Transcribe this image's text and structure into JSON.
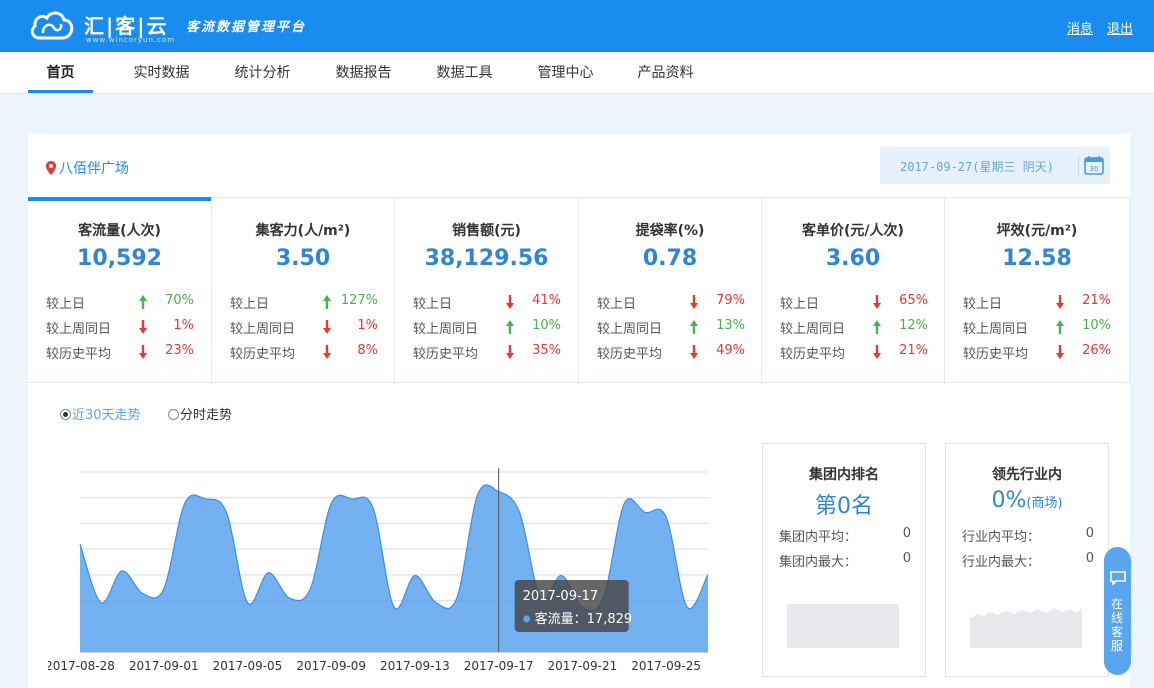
{
  "header": {
    "brand": "汇|客|云",
    "brand_sub": "www.wincoryun.com",
    "slogan": "客流数据管理平台",
    "links": {
      "messages": "消息",
      "logout": "退出"
    }
  },
  "nav": {
    "items": [
      "首页",
      "实时数据",
      "统计分析",
      "数据报告",
      "数据工具",
      "管理中心",
      "产品资料"
    ],
    "active_index": 0
  },
  "location": "八佰伴广场",
  "date_display": "2017-09-27(星期三 阴天)",
  "calendar_icon_text": "30",
  "kpis": [
    {
      "title": "客流量(人次)",
      "value": "10,592",
      "comparisons": [
        {
          "label": "较上日",
          "direction": "up",
          "pct": "70%"
        },
        {
          "label": "较上周同日",
          "direction": "down",
          "pct": "1%"
        },
        {
          "label": "较历史平均",
          "direction": "down",
          "pct": "23%"
        }
      ]
    },
    {
      "title": "集客力(人/m²)",
      "value": "3.50",
      "comparisons": [
        {
          "label": "较上日",
          "direction": "up",
          "pct": "127%"
        },
        {
          "label": "较上周同日",
          "direction": "down",
          "pct": "1%"
        },
        {
          "label": "较历史平均",
          "direction": "down",
          "pct": "8%"
        }
      ]
    },
    {
      "title": "销售额(元)",
      "value": "38,129.56",
      "comparisons": [
        {
          "label": "较上日",
          "direction": "down",
          "pct": "41%"
        },
        {
          "label": "较上周同日",
          "direction": "up",
          "pct": "10%"
        },
        {
          "label": "较历史平均",
          "direction": "down",
          "pct": "35%"
        }
      ]
    },
    {
      "title": "提袋率(%)",
      "value": "0.78",
      "comparisons": [
        {
          "label": "较上日",
          "direction": "down",
          "pct": "79%"
        },
        {
          "label": "较上周同日",
          "direction": "up",
          "pct": "13%"
        },
        {
          "label": "较历史平均",
          "direction": "down",
          "pct": "49%"
        }
      ]
    },
    {
      "title": "客单价(元/人次)",
      "value": "3.60",
      "comparisons": [
        {
          "label": "较上日",
          "direction": "down",
          "pct": "65%"
        },
        {
          "label": "较上周同日",
          "direction": "up",
          "pct": "12%"
        },
        {
          "label": "较历史平均",
          "direction": "down",
          "pct": "21%"
        }
      ]
    },
    {
      "title": "坪效(元/m²)",
      "value": "12.58",
      "comparisons": [
        {
          "label": "较上日",
          "direction": "down",
          "pct": "21%"
        },
        {
          "label": "较上周同日",
          "direction": "up",
          "pct": "10%"
        },
        {
          "label": "较历史平均",
          "direction": "down",
          "pct": "26%"
        }
      ]
    }
  ],
  "trend": {
    "options": [
      "近30天走势",
      "分时走势"
    ],
    "selected_index": 0
  },
  "chart_data": {
    "type": "area",
    "x": [
      "2017-08-28",
      "2017-08-29",
      "2017-08-30",
      "2017-08-31",
      "2017-09-01",
      "2017-09-02",
      "2017-09-03",
      "2017-09-04",
      "2017-09-05",
      "2017-09-06",
      "2017-09-07",
      "2017-09-08",
      "2017-09-09",
      "2017-09-10",
      "2017-09-11",
      "2017-09-12",
      "2017-09-13",
      "2017-09-14",
      "2017-09-15",
      "2017-09-16",
      "2017-09-17",
      "2017-09-18",
      "2017-09-19",
      "2017-09-20",
      "2017-09-21",
      "2017-09-22",
      "2017-09-23",
      "2017-09-24",
      "2017-09-25",
      "2017-09-26",
      "2017-09-27"
    ],
    "tick_labels": [
      "2017-08-28",
      "2017-09-01",
      "2017-09-05",
      "2017-09-09",
      "2017-09-13",
      "2017-09-17",
      "2017-09-21",
      "2017-09-25"
    ],
    "series": [
      {
        "values": [
          12000,
          5500,
          9000,
          6500,
          7000,
          16500,
          17000,
          15500,
          5500,
          8800,
          6000,
          7000,
          16500,
          17000,
          16000,
          5000,
          8500,
          5500,
          6000,
          17500,
          17829,
          15500,
          6000,
          8500,
          5000,
          6000,
          16500,
          15500,
          15000,
          5000,
          8600
        ]
      }
    ],
    "ylim": [
      0,
      20000
    ],
    "color": "#5aa3ee",
    "grid": true,
    "tooltip": {
      "date": "2017-09-17",
      "label": "客流量：17,829"
    }
  },
  "panels": [
    {
      "title": "集团内排名",
      "big": "第0名",
      "big_suffix": "",
      "rows": [
        {
          "label": "集团内平均：",
          "value": "0"
        },
        {
          "label": "集团内最大：",
          "value": "0"
        }
      ]
    },
    {
      "title": "领先行业内",
      "big": "0%",
      "big_suffix": "(商场)",
      "rows": [
        {
          "label": "行业内平均：",
          "value": "0"
        },
        {
          "label": "行业内最大：",
          "value": "0"
        }
      ]
    }
  ],
  "service_label": "在线客服",
  "colors": {
    "primary": "#1a8cf0",
    "up": "#4caf50",
    "down": "#e53935",
    "value": "#2f86d6"
  }
}
